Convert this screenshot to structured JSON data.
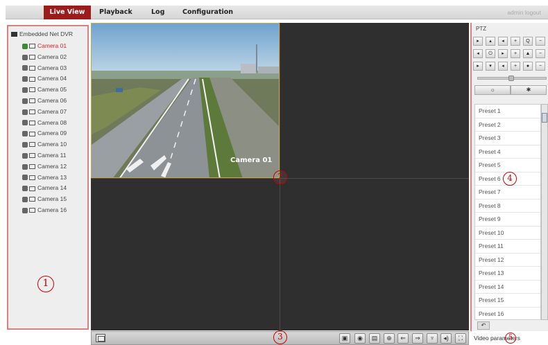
{
  "nav": {
    "live_view": "Live View",
    "playback": "Playback",
    "log": "Log",
    "configuration": "Configuration",
    "user": "admin  logout"
  },
  "tree": {
    "root": "Embedded Net DVR",
    "cameras": [
      "Camera 01",
      "Camera 02",
      "Camera 03",
      "Camera 04",
      "Camera 05",
      "Camera 06",
      "Camera 07",
      "Camera 08",
      "Camera 09",
      "Camera 10",
      "Camera 11",
      "Camera 12",
      "Camera 13",
      "Camera 14",
      "Camera 15",
      "Camera 16"
    ]
  },
  "video": {
    "cell_label": "Camera 01"
  },
  "ptz": {
    "title": "PTZ"
  },
  "presets": [
    "Preset 1",
    "Preset 2",
    "Preset 3",
    "Preset 4",
    "Preset 5",
    "Preset 6",
    "Preset 7",
    "Preset 8",
    "Preset 9",
    "Preset 10",
    "Preset 11",
    "Preset 12",
    "Preset 13",
    "Preset 14",
    "Preset 15",
    "Preset 16"
  ],
  "video_parameters": "Video parameters",
  "annotations": [
    "1",
    "2",
    "3",
    "4",
    "5"
  ],
  "colors": {
    "accent": "#9c1b1b",
    "annotation": "#cc0000"
  }
}
